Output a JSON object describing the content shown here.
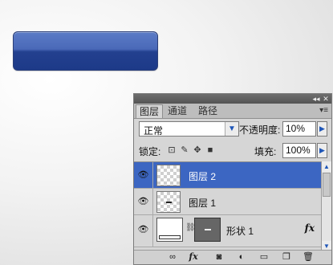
{
  "panel": {
    "tabs": [
      {
        "label": "图层",
        "active": true
      },
      {
        "label": "通道",
        "active": false
      },
      {
        "label": "路径",
        "active": false
      }
    ],
    "blend_mode": "正常",
    "opacity_label": "不透明度:",
    "opacity_value": "10%",
    "lock_label": "锁定:",
    "fill_label": "填充:",
    "fill_value": "100%",
    "layers": [
      {
        "name": "图层 2",
        "selected": true,
        "visible": true
      },
      {
        "name": "图层 1",
        "selected": false,
        "visible": true
      },
      {
        "name": "形状 1",
        "selected": false,
        "visible": true,
        "fx": "fx"
      }
    ]
  },
  "colors": {
    "accent": "#3c66c2",
    "button_blue": "#23408f",
    "panel_bg": "#d6d6d6"
  },
  "icons": {
    "eye": "eye-icon",
    "link": "link-icon",
    "fx": "fx-icon",
    "mask": "mask-icon",
    "adjustment": "adjustment-icon",
    "folder": "folder-icon",
    "new_layer": "new-layer-icon",
    "trash": "trash-icon"
  }
}
